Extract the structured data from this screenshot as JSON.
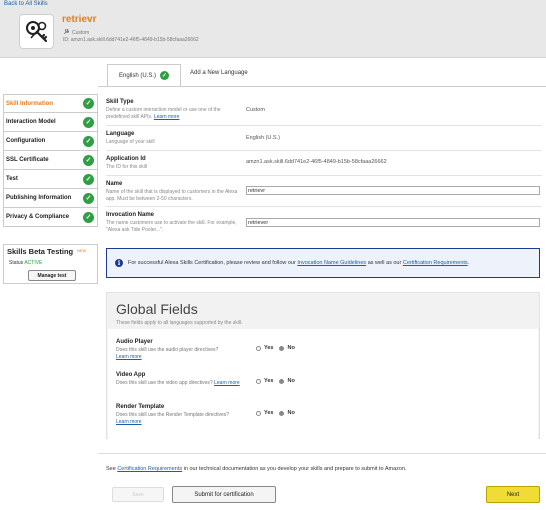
{
  "header": {
    "back_link": "Back to All Skills",
    "skill_name": "retrievr",
    "skill_type": "Custom",
    "id_label": "ID:",
    "skill_id": "amzn1.ask.skill.6dd741e2-46f5-4849-b15b-58cfaaa26662",
    "icon": "skill-logo-icon",
    "type_icon": "wrench-icon"
  },
  "tabs": [
    {
      "label": "English (U.S.)",
      "status_icon": "check-icon",
      "active": true
    },
    {
      "label": "Add a New Language",
      "active": false
    }
  ],
  "sidebar": {
    "items": [
      {
        "label": "Skill Information",
        "active": true
      },
      {
        "label": "Interaction Model",
        "active": false
      },
      {
        "label": "Configuration",
        "active": false
      },
      {
        "label": "SSL Certificate",
        "active": false
      },
      {
        "label": "Test",
        "active": false
      },
      {
        "label": "Publishing Information",
        "active": false
      },
      {
        "label": "Privacy & Compliance",
        "active": false
      }
    ],
    "check_mark": "✓"
  },
  "beta": {
    "title": "Skills Beta Testing",
    "badge": "NEW",
    "status_label": "Status",
    "status_value": "ACTIVE",
    "manage_button": "Manage test"
  },
  "form": {
    "skill_type": {
      "label": "Skill Type",
      "desc": "Define a custom interaction model or use one of the predefined skill APIs.",
      "learn_more": "Learn more",
      "value": "Custom"
    },
    "language": {
      "label": "Language",
      "desc": "Language of your skill",
      "value": "English (U.S.)"
    },
    "application_id": {
      "label": "Application Id",
      "desc": "The ID for this skill",
      "value": "amzn1.ask.skill.6dd741e2-46f5-4849-b15b-58cfaaa26662"
    },
    "name": {
      "label": "Name",
      "desc": "Name of the skill that is displayed to customers in the Alexa app. Must be between 2-50 characters.",
      "value": "retrievr"
    },
    "invocation": {
      "label": "Invocation Name",
      "desc": "The name customers use to activate the skill. For example, \"Alexa ask Tide Pooler...\".",
      "value": "retriever"
    }
  },
  "info": {
    "icon": "info-icon",
    "text_before": "For successful Alexa Skills Certification, please review and follow our",
    "link1": "Invocation Name Guidelines",
    "text_middle": "as well as our",
    "link2": "Certification Requirements",
    "text_after": "."
  },
  "global": {
    "title": "Global Fields",
    "subtitle": "These fields apply to all languages supported by the skill.",
    "yes_label": "Yes",
    "no_label": "No",
    "fields": [
      {
        "label": "Audio Player",
        "desc": "Does this skill use the audio player directives?",
        "learn_more": "Learn more",
        "selected": "No"
      },
      {
        "label": "Video App",
        "desc": "Does this skill use the video app directives?",
        "learn_more": "Learn more",
        "selected": "No"
      },
      {
        "label": "Render Template",
        "desc": "Does this skill use the Render Template directives?",
        "learn_more": "Learn more",
        "selected": "No"
      }
    ]
  },
  "footer": {
    "text_before": "See",
    "link": "Certification Requirements",
    "text_after": "in our technical documentation as you develop your skills and prepare to submit to Amazon.",
    "save_button": "Save",
    "submit_button": "Submit for certification",
    "next_button": "Next"
  },
  "colors": {
    "accent": "#e67e22",
    "check": "#2f9e44",
    "link": "#1a5fa8",
    "info_border": "#1f3a93",
    "next_button": "#f1dc36"
  }
}
